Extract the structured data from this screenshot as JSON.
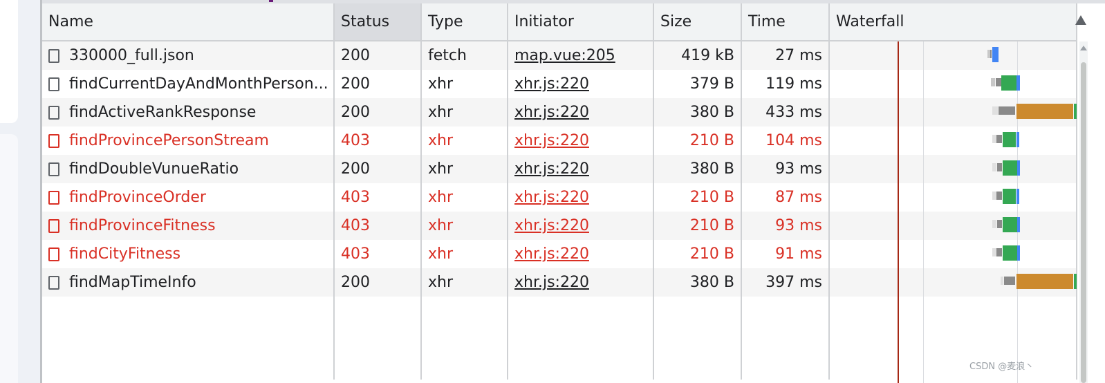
{
  "columns": {
    "name": "Name",
    "status": "Status",
    "type": "Type",
    "initiator": "Initiator",
    "size": "Size",
    "time": "Time",
    "waterfall": "Waterfall"
  },
  "rows": [
    {
      "name": "330000_full.json",
      "status": "200",
      "type": "fetch",
      "initiator": "map.vue:205",
      "size": "419 kB",
      "time": "27 ms",
      "error": false
    },
    {
      "name": "findCurrentDayAndMonthPerson...",
      "status": "200",
      "type": "xhr",
      "initiator": "xhr.js:220",
      "size": "379 B",
      "time": "119 ms",
      "error": false
    },
    {
      "name": "findActiveRankResponse",
      "status": "200",
      "type": "xhr",
      "initiator": "xhr.js:220",
      "size": "380 B",
      "time": "433 ms",
      "error": false
    },
    {
      "name": "findProvincePersonStream",
      "status": "403",
      "type": "xhr",
      "initiator": "xhr.js:220",
      "size": "210 B",
      "time": "104 ms",
      "error": true
    },
    {
      "name": "findDoubleVunueRatio",
      "status": "200",
      "type": "xhr",
      "initiator": "xhr.js:220",
      "size": "380 B",
      "time": "93 ms",
      "error": false
    },
    {
      "name": "findProvinceOrder",
      "status": "403",
      "type": "xhr",
      "initiator": "xhr.js:220",
      "size": "210 B",
      "time": "87 ms",
      "error": true
    },
    {
      "name": "findProvinceFitness",
      "status": "403",
      "type": "xhr",
      "initiator": "xhr.js:220",
      "size": "210 B",
      "time": "93 ms",
      "error": true
    },
    {
      "name": "findCityFitness",
      "status": "403",
      "type": "xhr",
      "initiator": "xhr.js:220",
      "size": "210 B",
      "time": "91 ms",
      "error": true
    },
    {
      "name": "findMapTimeInfo",
      "status": "200",
      "type": "xhr",
      "initiator": "xhr.js:220",
      "size": "380 B",
      "time": "397 ms",
      "error": false
    }
  ],
  "colors": {
    "error": "#d93025",
    "waiting_green": "#34a853",
    "download_blue": "#4285f4",
    "long_wait_orange": "#cc8a2e",
    "stalled_gray": "#8a8a8a"
  },
  "icons": {
    "sort": "triangle-up-icon",
    "file": "document-icon"
  },
  "watermark": "CSDN @麦浪丶"
}
